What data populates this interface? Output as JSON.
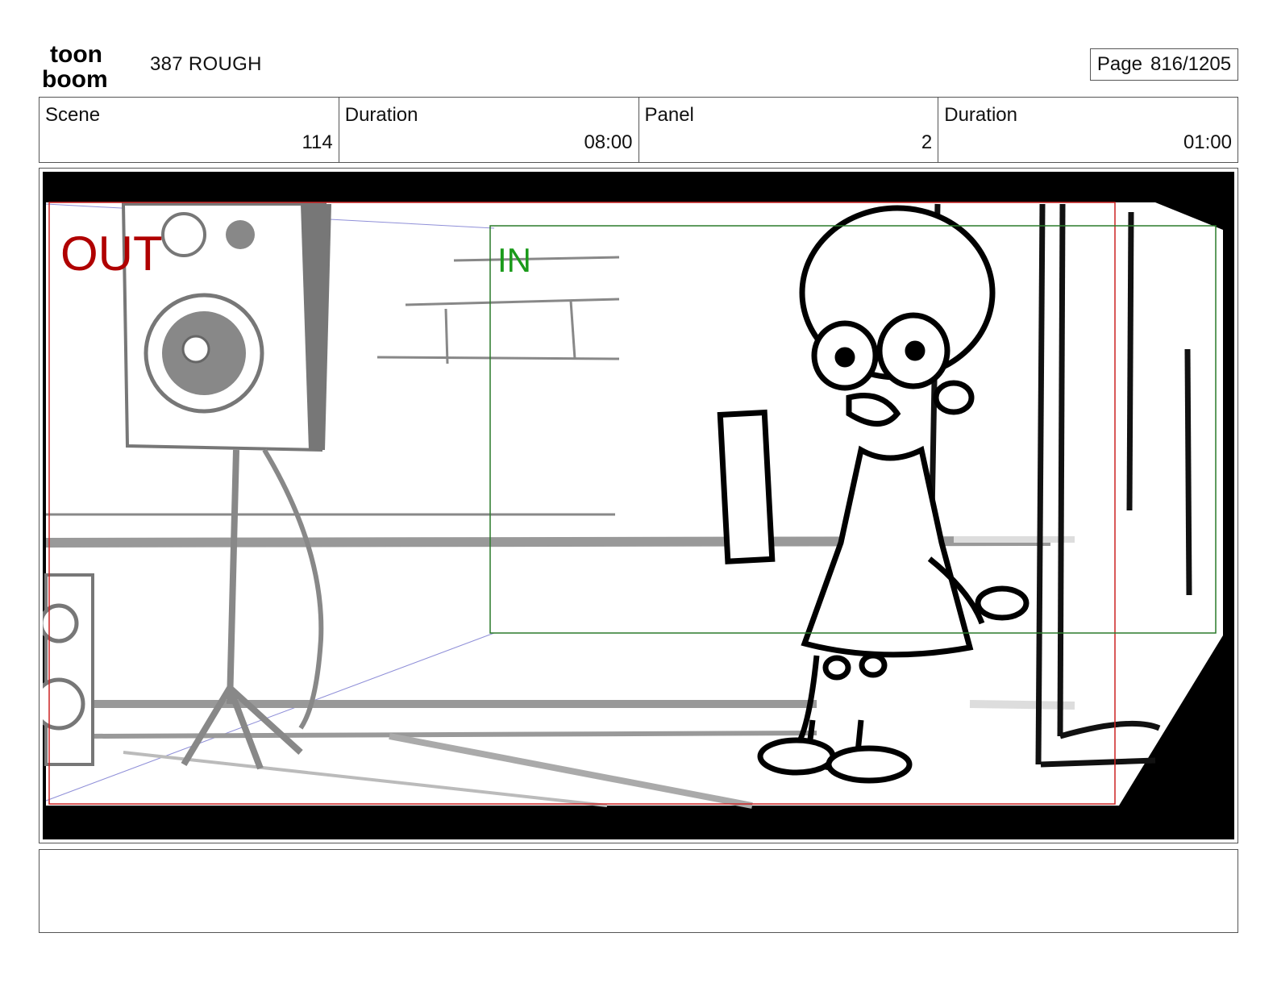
{
  "header": {
    "logo_top": "toon",
    "logo_bottom": "boom",
    "title": "387 ROUGH",
    "page_label": "Page",
    "page_value": "816/1205"
  },
  "info": {
    "scene_label": "Scene",
    "scene_value": "114",
    "duration_label": "Duration",
    "duration_value": "08:00",
    "panel_label": "Panel",
    "panel_value": "2",
    "panel_duration_label": "Duration",
    "panel_duration_value": "01:00"
  },
  "panel": {
    "out_label": "OUT",
    "in_label": "IN",
    "out_color": "#b00000",
    "in_color": "#1a9a1a",
    "frame_colors": {
      "out": "#cc2222",
      "in": "#2a7a2a"
    }
  },
  "notes": {
    "text": ""
  }
}
